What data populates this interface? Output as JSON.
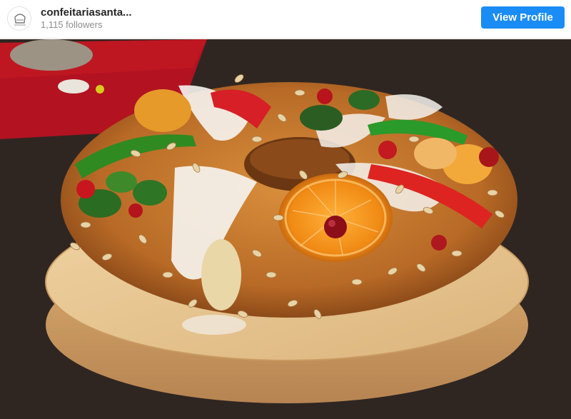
{
  "profile": {
    "username": "confeitariasanta...",
    "followers": "1,115 followers",
    "view_profile_label": "View Profile",
    "avatar_icon": "bakery-logo-icon"
  },
  "post": {
    "image_subject": "photo"
  },
  "colors": {
    "button": "#1a8cf6",
    "username": "#262626",
    "followers": "#8e8e8e"
  }
}
